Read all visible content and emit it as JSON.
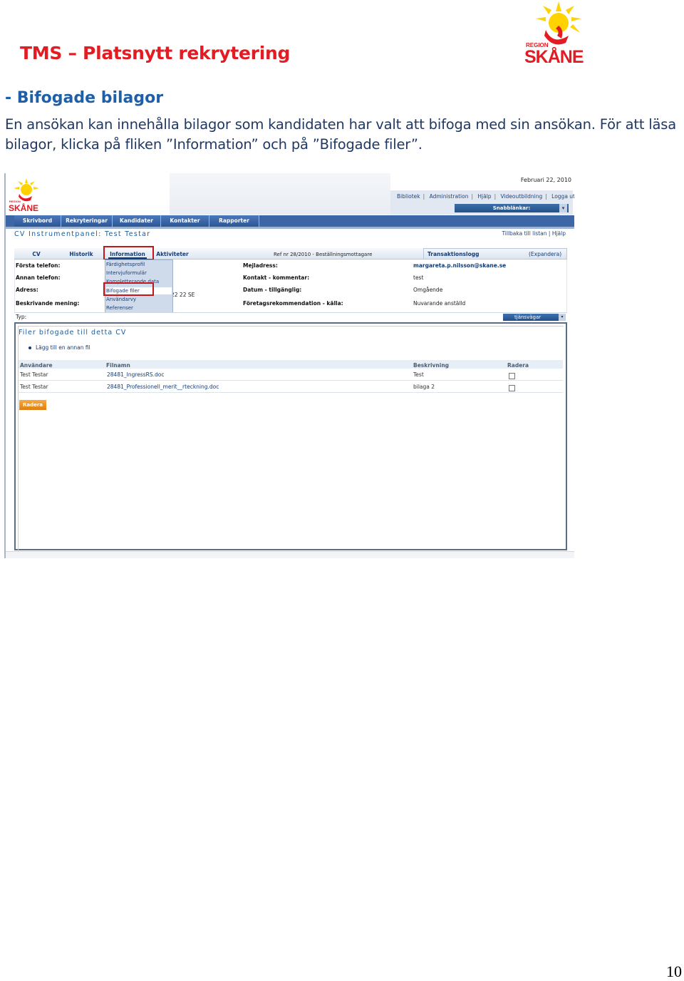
{
  "document": {
    "title": "TMS – Platsnytt rekrytering",
    "section_heading": "- Bifogade bilagor",
    "body_text": "En ansökan kan innehålla bilagor som kandidaten har valt att bifoga med sin ansökan. För att läsa bilagor, klicka på fliken ”Information” och på ”Bifogade filer”.",
    "page_number": "10",
    "logo": {
      "region_text": "REGION",
      "name_text": "SKÅNE",
      "accent": "#e31b23",
      "yellow": "#ffd200"
    }
  },
  "screenshot": {
    "date": "Februari 22, 2010",
    "top_links": [
      "Bibliotek",
      "Administration",
      "Hjälp",
      "Videoutbildning",
      "Logga ut"
    ],
    "quick_select": "Snabblänkar:",
    "nav": [
      "Skrivbord",
      "Rekryteringar",
      "Kandidater",
      "Kontakter",
      "Rapporter"
    ],
    "page_title": "CV Instrumentpanel: Test Testar",
    "back_links": "Tillbaka till listan | Hjälp",
    "tabs": [
      "CV",
      "Historik",
      "Information",
      "Aktiviteter"
    ],
    "ref_text": "Ref nr 28/2010 - Beställningsmottagare",
    "transactions": {
      "label": "Transaktionslogg",
      "expand": "(Expandera)"
    },
    "left_labels": [
      "Första telefon:",
      "Annan telefon:",
      "Adress:",
      "Beskrivande mening:"
    ],
    "address_fragment": "22 22 SE",
    "right_labels": [
      "Mejladress:",
      "Kontakt - kommentar:",
      "Datum - tillgänglig:",
      "Företagsrekommendation - källa:"
    ],
    "right_values": [
      "margareta.p.nilsson@skane.se",
      "test",
      "Omgående",
      "Nuvarande anställd"
    ],
    "dropdown_items": [
      "Färdighetsprofil",
      "Intervjuformulär",
      "Kompletterande data",
      "Bifogade filer",
      "Användarvy",
      "Referenser"
    ],
    "type_label": "Typ:",
    "service_select": "tjänsvägar",
    "files": {
      "title": "Filer bifogade till detta CV",
      "add_link": "Lägg till en annan fil",
      "headers": [
        "Användare",
        "Filnamn",
        "Beskrivning",
        "Radera"
      ],
      "rows": [
        {
          "user": "Test Testar",
          "file": "28481_IngressRS.doc",
          "desc": "Test"
        },
        {
          "user": "Test Testar",
          "file": "28481_Professionell_merit__rteckning.doc",
          "desc": "bilaga 2"
        }
      ],
      "delete_button": "Radera"
    },
    "colors": {
      "nav": "#3c66a5",
      "highlight": "#c0171d",
      "button": "#f29422"
    }
  }
}
